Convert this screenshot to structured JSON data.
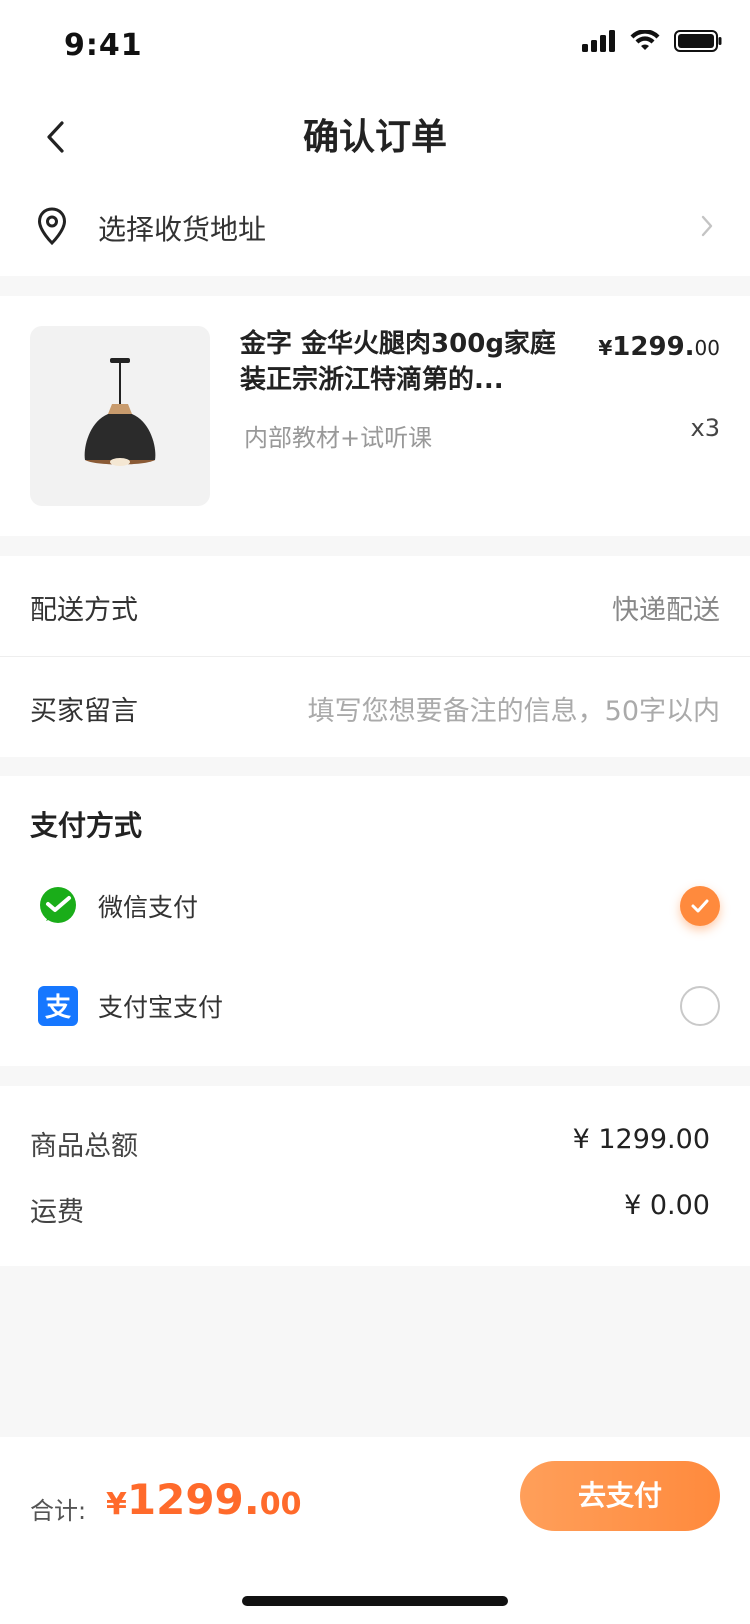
{
  "status_bar": {
    "time": "9:41"
  },
  "header": {
    "title": "确认订单"
  },
  "address": {
    "label": "选择收货地址"
  },
  "product": {
    "title": "金字 金华火腿肉300g家庭装正宗浙江特滴第的...",
    "subtitle": "内部教材+试听课",
    "price_currency": "¥",
    "price_integer": "1299.",
    "price_decimal": "00",
    "quantity": "x3"
  },
  "info": [
    {
      "key": "配送方式",
      "value": "快递配送"
    },
    {
      "key": "买家留言",
      "value": "填写您想要备注的信息，50字以内"
    }
  ],
  "payment": {
    "title": "支付方式",
    "methods": [
      {
        "name": "微信支付",
        "icon": "wechat-pay-icon",
        "selected": true
      },
      {
        "name": "支付宝支付",
        "icon": "alipay-icon",
        "selected": false
      }
    ]
  },
  "summary": [
    {
      "key": "商品总额",
      "value": "¥ 1299.00"
    },
    {
      "key": "运费",
      "value": "¥ 0.00"
    }
  ],
  "footer": {
    "total_label": "合计:",
    "total_currency": "¥",
    "total_integer": "1299.",
    "total_decimal": "00",
    "pay_button": "去支付"
  },
  "colors": {
    "accent": "#ff8a3d",
    "price": "#ff6a2b",
    "wechat": "#1aad19",
    "alipay": "#1677ff"
  }
}
